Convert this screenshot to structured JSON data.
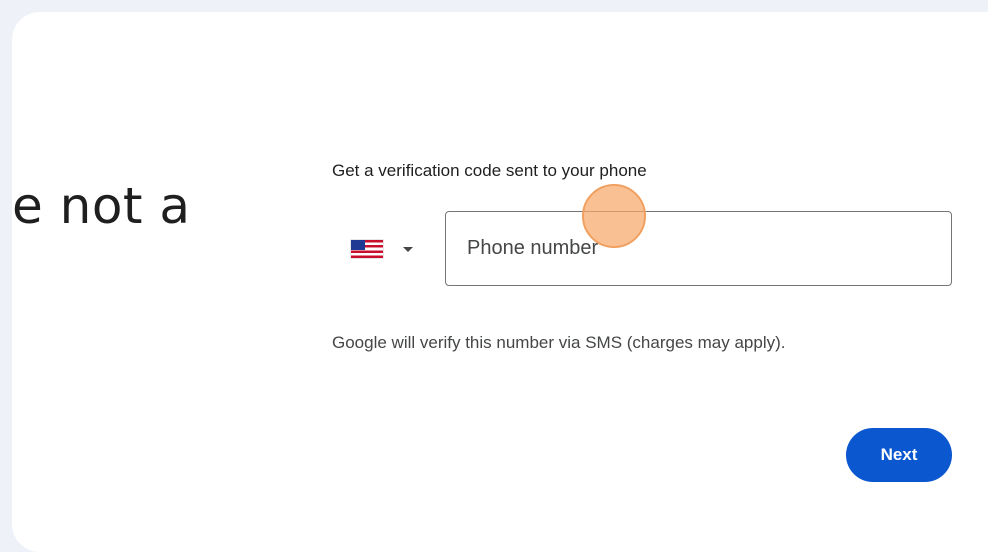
{
  "heading": {
    "partial_text": "e not a"
  },
  "verification": {
    "instruction": "Get a verification code sent to your phone",
    "country": {
      "flag_icon": "us-flag-icon",
      "dropdown_icon": "caret-down-icon"
    },
    "phone_input": {
      "placeholder": "Phone number",
      "value": ""
    },
    "sms_note": "Google will verify this number via SMS (charges may apply).",
    "next_label": "Next"
  },
  "colors": {
    "background": "#eef2f8",
    "card": "#ffffff",
    "primary_button": "#0b57d0",
    "click_indicator": "#f6a769"
  }
}
